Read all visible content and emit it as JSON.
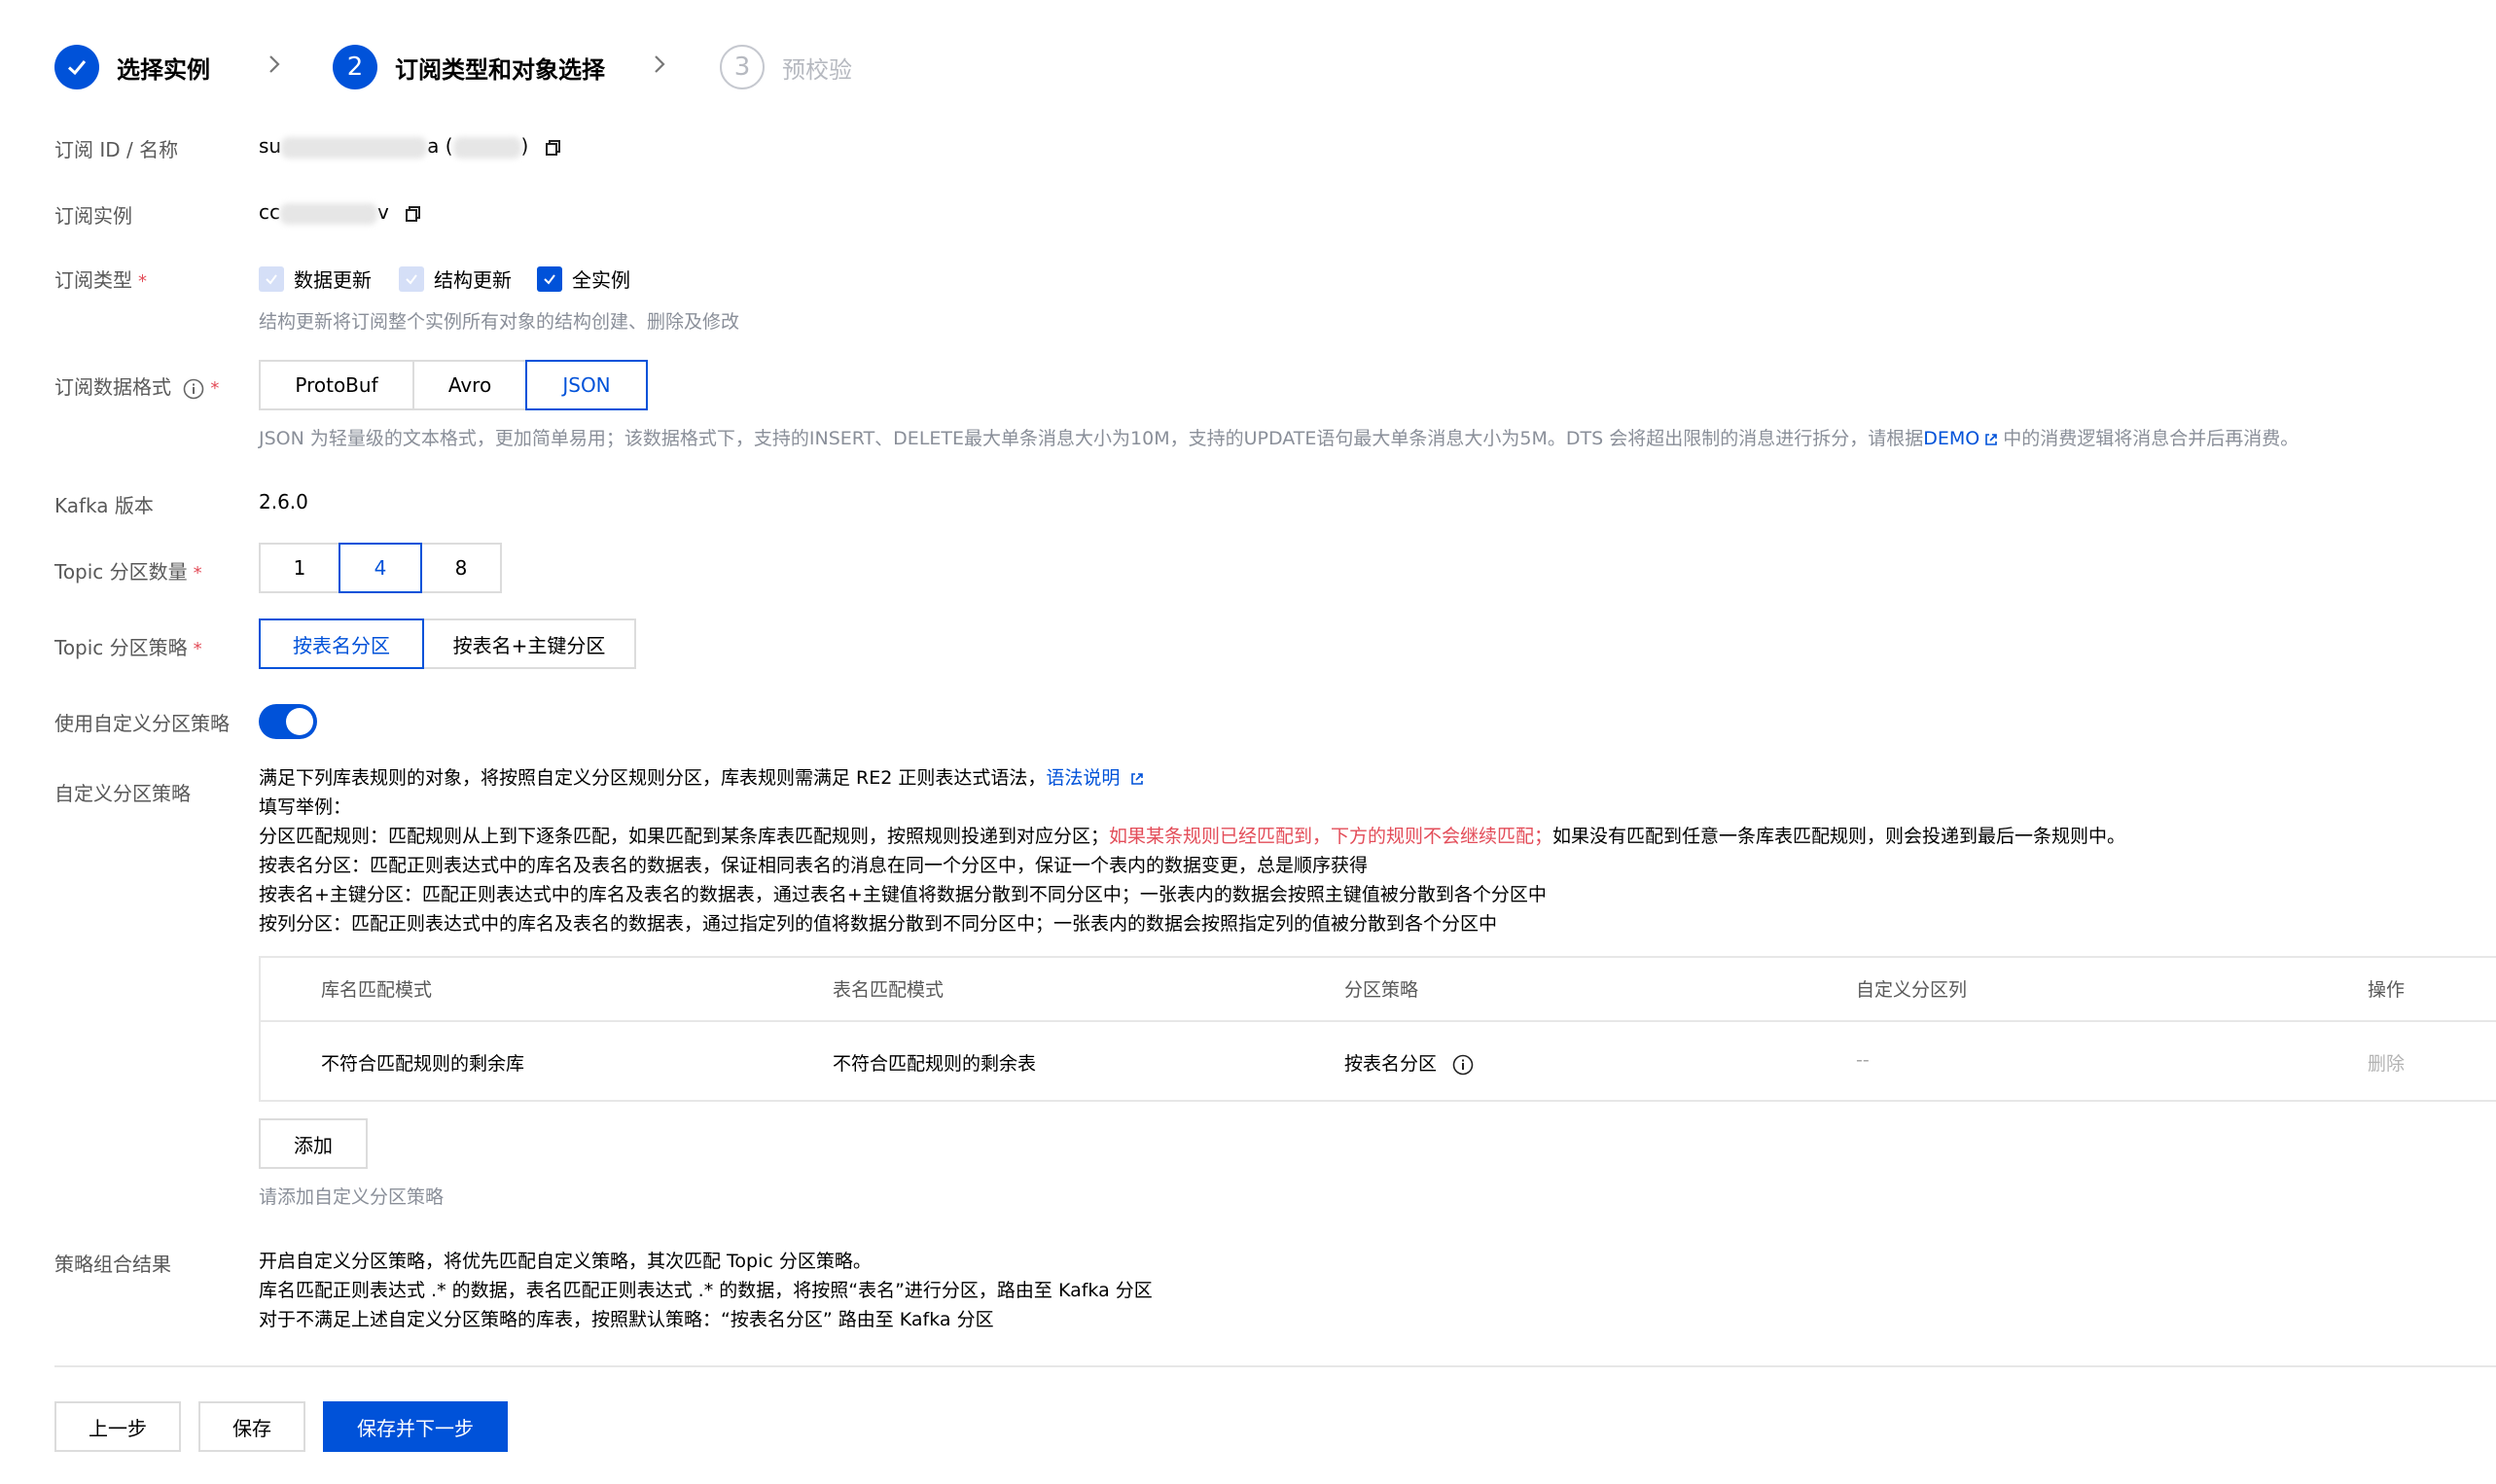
{
  "steps": [
    {
      "label": "选择实例",
      "number": "1",
      "state": "done"
    },
    {
      "label": "订阅类型和对象选择",
      "number": "2",
      "state": "active"
    },
    {
      "label": "预校验",
      "number": "3",
      "state": "pending"
    }
  ],
  "form": {
    "sub_id": {
      "label": "订阅 ID / 名称",
      "prefix": "su",
      "mid": "a (",
      "suffix": ")"
    },
    "instance": {
      "label": "订阅实例",
      "prefix": "cc",
      "suffix": "v"
    },
    "sub_type": {
      "label": "订阅类型",
      "options": [
        "数据更新",
        "结构更新",
        "全实例"
      ],
      "hint": "结构更新将订阅整个实例所有对象的结构创建、删除及修改"
    },
    "format": {
      "label": "订阅数据格式",
      "options": [
        "ProtoBuf",
        "Avro",
        "JSON"
      ],
      "selected": "JSON",
      "hint_before": "JSON 为轻量级的文本格式，更加简单易用；该数据格式下，支持的INSERT、DELETE最大单条消息大小为10M，支持的UPDATE语句最大单条消息大小为5M。DTS 会将超出限制的消息进行拆分，请根据",
      "hint_link": "DEMO",
      "hint_after": "中的消费逻辑将消息合并后再消费。"
    },
    "kafka": {
      "label": "Kafka 版本",
      "value": "2.6.0"
    },
    "partitions": {
      "label": "Topic 分区数量",
      "options": [
        "1",
        "4",
        "8"
      ],
      "selected": "4"
    },
    "strategy": {
      "label": "Topic 分区策略",
      "options": [
        "按表名分区",
        "按表名+主键分区"
      ],
      "selected": "按表名分区"
    },
    "custom_toggle": {
      "label": "使用自定义分区策略",
      "on": true
    },
    "custom_strategy": {
      "label": "自定义分区策略",
      "line1": "满足下列库表规则的对象，将按照自定义分区规则分区，库表规则需满足 RE2 正则表达式语法，",
      "line1_link": "语法说明",
      "line2": "填写举例：",
      "line3_a": "分区匹配规则：匹配规则从上到下逐条匹配，如果匹配到某条库表匹配规则，按照规则投递到对应分区；",
      "line3_red": "如果某条规则已经匹配到，下方的规则不会继续匹配；",
      "line3_b": "如果没有匹配到任意一条库表匹配规则，则会投递到最后一条规则中。",
      "line4": "按表名分区：匹配正则表达式中的库名及表名的数据表，保证相同表名的消息在同一个分区中，保证一个表内的数据变更，总是顺序获得",
      "line5": "按表名+主键分区：匹配正则表达式中的库名及表名的数据表，通过表名+主键值将数据分散到不同分区中；一张表内的数据会按照主键值被分散到各个分区中",
      "line6": "按列分区：匹配正则表达式中的库名及表名的数据表，通过指定列的值将数据分散到不同分区中；一张表内的数据会按照指定列的值被分散到各个分区中"
    },
    "table": {
      "headers": [
        "库名匹配模式",
        "表名匹配模式",
        "分区策略",
        "自定义分区列",
        "操作"
      ],
      "row": {
        "db": "不符合匹配规则的剩余库",
        "tbl": "不符合匹配规则的剩余表",
        "strategy": "按表名分区",
        "column": "--",
        "action": "删除"
      }
    },
    "add_button": "添加",
    "add_hint": "请添加自定义分区策略",
    "result": {
      "label": "策略组合结果",
      "line1": "开启自定义分区策略，将优先匹配自定义策略，其次匹配 Topic 分区策略。",
      "line2": "库名匹配正则表达式 .* 的数据，表名匹配正则表达式 .* 的数据，将按照“表名”进行分区，路由至 Kafka 分区",
      "line3": "对于不满足上述自定义分区策略的库表，按照默认策略：“按表名分区” 路由至 Kafka 分区"
    }
  },
  "footer": {
    "prev": "上一步",
    "save": "保存",
    "save_next": "保存并下一步"
  },
  "colors": {
    "primary": "#0052d9",
    "required": "#e34d59",
    "muted": "#8a8f99"
  }
}
